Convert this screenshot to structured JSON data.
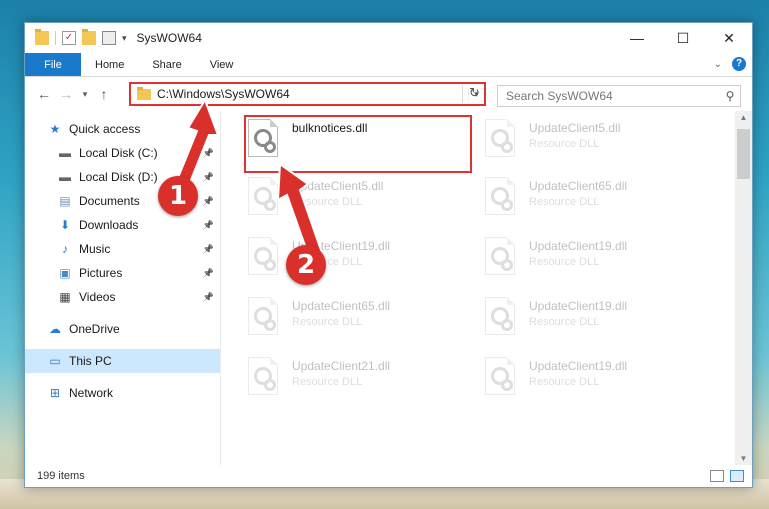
{
  "window": {
    "title": "SysWOW64"
  },
  "ribbon": {
    "tabs": [
      "File",
      "Home",
      "Share",
      "View"
    ],
    "help": "?"
  },
  "address": {
    "path": "C:\\Windows\\SysWOW64"
  },
  "search": {
    "placeholder": "Search SysWOW64"
  },
  "nav": {
    "items": [
      {
        "label": "Quick access",
        "icon": "star-icon",
        "pinned": false
      },
      {
        "label": "Local Disk (C:)",
        "icon": "drive-icon",
        "pinned": true
      },
      {
        "label": "Local Disk (D:)",
        "icon": "drive-icon",
        "pinned": true
      },
      {
        "label": "Documents",
        "icon": "documents-icon",
        "pinned": true
      },
      {
        "label": "Downloads",
        "icon": "download-icon",
        "pinned": true
      },
      {
        "label": "Music",
        "icon": "music-icon",
        "pinned": true
      },
      {
        "label": "Pictures",
        "icon": "pictures-icon",
        "pinned": true
      },
      {
        "label": "Videos",
        "icon": "videos-icon",
        "pinned": true
      },
      {
        "label": "OneDrive",
        "icon": "cloud-icon",
        "pinned": false
      },
      {
        "label": "This PC",
        "icon": "computer-icon",
        "pinned": false
      },
      {
        "label": "Network",
        "icon": "network-icon",
        "pinned": false
      }
    ]
  },
  "files": [
    {
      "name": "bulknotices.dll",
      "type": ""
    },
    {
      "name": "UpdateClient5.dll",
      "type": "Resource DLL"
    },
    {
      "name": "UpdateClient5.dll",
      "type": "Resource DLL"
    },
    {
      "name": "UpdateClient65.dll",
      "type": "Resource DLL"
    },
    {
      "name": "UpdateClient19.dll",
      "type": "Resource DLL"
    },
    {
      "name": "UpdateClient19.dll",
      "type": "Resource DLL"
    },
    {
      "name": "UpdateClient65.dll",
      "type": "Resource DLL"
    },
    {
      "name": "UpdateClient19.dll",
      "type": "Resource DLL"
    },
    {
      "name": "UpdateClient21.dll",
      "type": "Resource DLL"
    },
    {
      "name": "UpdateClient19.dll",
      "type": "Resource DLL"
    }
  ],
  "status": {
    "count": "199 items"
  },
  "annotations": {
    "step1": "1",
    "step2": "2"
  },
  "colors": {
    "accent": "#1979ca",
    "annotation": "#d9302c",
    "selection": "#cce8ff"
  }
}
